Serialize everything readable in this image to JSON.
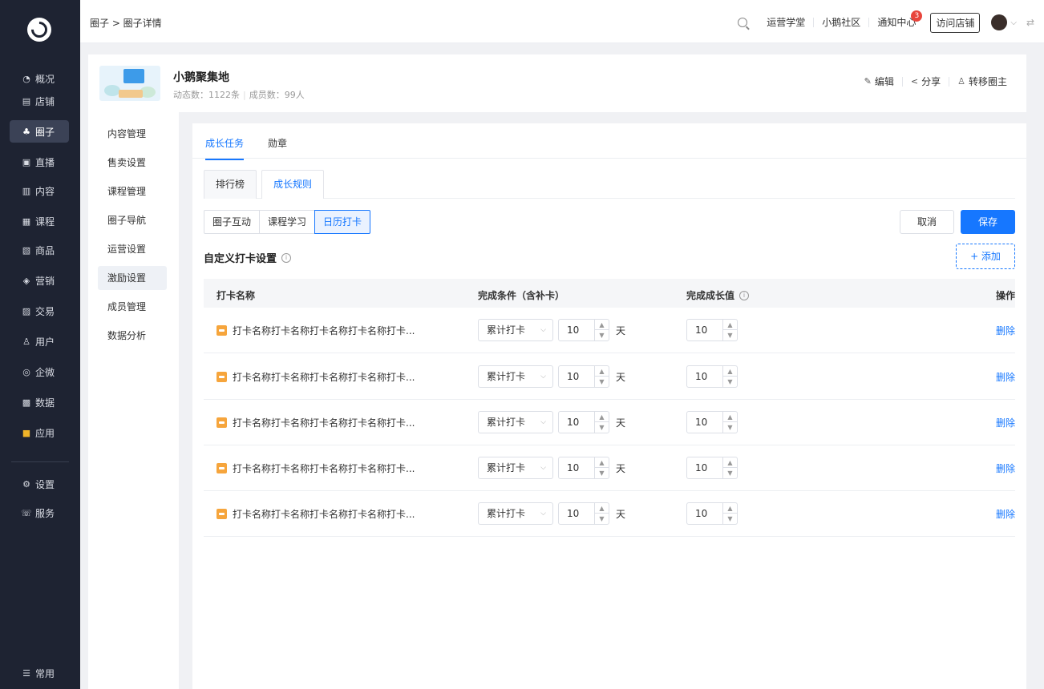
{
  "sidebar": {
    "items": [
      {
        "label": "概况",
        "icon": "◔",
        "icon_name": "overview-icon"
      },
      {
        "label": "店铺",
        "icon": "▤",
        "icon_name": "store-icon"
      },
      {
        "label": "圈子",
        "icon": "♣",
        "icon_name": "circle-icon",
        "active": true
      },
      {
        "label": "直播",
        "icon": "▣",
        "icon_name": "live-icon"
      },
      {
        "label": "内容",
        "icon": "▥",
        "icon_name": "content-icon"
      },
      {
        "label": "课程",
        "icon": "▦",
        "icon_name": "course-icon"
      },
      {
        "label": "商品",
        "icon": "▧",
        "icon_name": "goods-icon"
      },
      {
        "label": "营销",
        "icon": "◈",
        "icon_name": "marketing-icon"
      },
      {
        "label": "交易",
        "icon": "▨",
        "icon_name": "trade-icon"
      },
      {
        "label": "用户",
        "icon": "♙",
        "icon_name": "user-icon"
      },
      {
        "label": "企微",
        "icon": "◎",
        "icon_name": "wecom-icon"
      },
      {
        "label": "数据",
        "icon": "▩",
        "icon_name": "data-icon"
      },
      {
        "label": "应用",
        "icon": "■",
        "icon_name": "apps-icon"
      }
    ],
    "bottom_items": [
      {
        "label": "设置",
        "icon": "⚙",
        "icon_name": "settings-icon"
      },
      {
        "label": "服务",
        "icon": "☏",
        "icon_name": "service-icon"
      }
    ],
    "footer": {
      "label": "常用",
      "icon": "☰",
      "icon_name": "common-icon"
    }
  },
  "topbar": {
    "breadcrumb": "圈子 > 圈子详情",
    "links": [
      "运营学堂",
      "小鹅社区",
      "通知中心"
    ],
    "notice_count": "3",
    "visit_button": "访问店铺"
  },
  "circle": {
    "name": "小鹅聚集地",
    "posts": "动态数：1122条",
    "members": "成员数：99人",
    "actions": [
      "编辑",
      "分享",
      "转移圈主"
    ]
  },
  "submenu": {
    "items": [
      "内容管理",
      "售卖设置",
      "课程管理",
      "圈子导航",
      "运营设置",
      "激励设置",
      "成员管理",
      "数据分析"
    ],
    "active_index": 5
  },
  "tabs": [
    "成长任务",
    "勋章"
  ],
  "subtabs": [
    "排行榜",
    "成长规则"
  ],
  "segments": [
    "圈子互动",
    "课程学习",
    "日历打卡"
  ],
  "buttons": {
    "cancel": "取消",
    "save": "保存",
    "add": "+ 添加"
  },
  "section_title": "自定义打卡设置",
  "table": {
    "headers": [
      "打卡名称",
      "完成条件（含补卡）",
      "完成成长值",
      "操作"
    ],
    "rows": [
      {
        "name": "打卡名称打卡名称打卡名称打卡名称打卡...",
        "condition": "累计打卡",
        "days": "10",
        "unit": "天",
        "growth": "10",
        "action": "删除"
      },
      {
        "name": "打卡名称打卡名称打卡名称打卡名称打卡...",
        "condition": "累计打卡",
        "days": "10",
        "unit": "天",
        "growth": "10",
        "action": "删除"
      },
      {
        "name": "打卡名称打卡名称打卡名称打卡名称打卡...",
        "condition": "累计打卡",
        "days": "10",
        "unit": "天",
        "growth": "10",
        "action": "删除"
      },
      {
        "name": "打卡名称打卡名称打卡名称打卡名称打卡...",
        "condition": "累计打卡",
        "days": "10",
        "unit": "天",
        "growth": "10",
        "action": "删除"
      },
      {
        "name": "打卡名称打卡名称打卡名称打卡名称打卡...",
        "condition": "累计打卡",
        "days": "10",
        "unit": "天",
        "growth": "10",
        "action": "删除"
      }
    ]
  },
  "colors": {
    "primary": "#1677ff",
    "sidebar_bg": "#1e2332",
    "badge": "#e8453c"
  }
}
